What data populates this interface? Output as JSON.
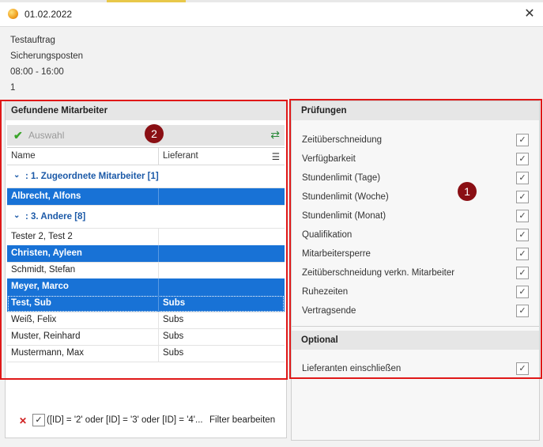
{
  "window": {
    "title": "01.02.2022",
    "close_icon": "close-icon"
  },
  "info": [
    "Testauftrag",
    "Sicherungsposten",
    "08:00 - 16:00",
    "1"
  ],
  "left": {
    "header": "Gefundene Mitarbeiter",
    "toolbar": {
      "select_label": "Auswahl"
    },
    "columns": {
      "name": "Name",
      "supplier": "Lieferant"
    },
    "groups": [
      {
        "label": ": 1. Zugeordnete Mitarbeiter [1]"
      },
      {
        "label": ": 3. Andere [8]"
      }
    ],
    "rows": [
      {
        "name": "Albrecht, Alfons",
        "supplier": ""
      },
      {
        "name": "Tester 2, Test 2",
        "supplier": ""
      },
      {
        "name": "Christen, Ayleen",
        "supplier": ""
      },
      {
        "name": "Schmidt, Stefan",
        "supplier": ""
      },
      {
        "name": "Meyer, Marco",
        "supplier": ""
      },
      {
        "name": "Test, Sub",
        "supplier": "Subs"
      },
      {
        "name": "Weiß, Felix",
        "supplier": "Subs"
      },
      {
        "name": "Muster, Reinhard",
        "supplier": "Subs"
      },
      {
        "name": "Mustermann, Max",
        "supplier": "Subs"
      }
    ],
    "filter": {
      "text": "([ID] = '2' oder [ID] = '3' oder [ID] = '4'...",
      "edit_label": "Filter bearbeiten"
    }
  },
  "right": {
    "checks_header": "Prüfungen",
    "checks": [
      {
        "label": "Zeitüberschneidung",
        "checked": true
      },
      {
        "label": "Verfügbarkeit",
        "checked": true
      },
      {
        "label": "Stundenlimit (Tage)",
        "checked": true
      },
      {
        "label": "Stundenlimit (Woche)",
        "checked": true
      },
      {
        "label": "Stundenlimit (Monat)",
        "checked": true
      },
      {
        "label": "Qualifikation",
        "checked": true
      },
      {
        "label": "Mitarbeitersperre",
        "checked": true
      },
      {
        "label": "Zeitüberschneidung verkn. Mitarbeiter",
        "checked": true
      },
      {
        "label": "Ruhezeiten",
        "checked": true
      },
      {
        "label": "Vertragsende",
        "checked": true
      }
    ],
    "optional_header": "Optional",
    "optional": [
      {
        "label": "Lieferanten einschließen",
        "checked": true
      }
    ]
  },
  "markers": {
    "m1": "1",
    "m2": "2"
  },
  "colors": {
    "selection": "#1872d6",
    "highlight": "#e01818",
    "marker": "#8a0f14"
  }
}
